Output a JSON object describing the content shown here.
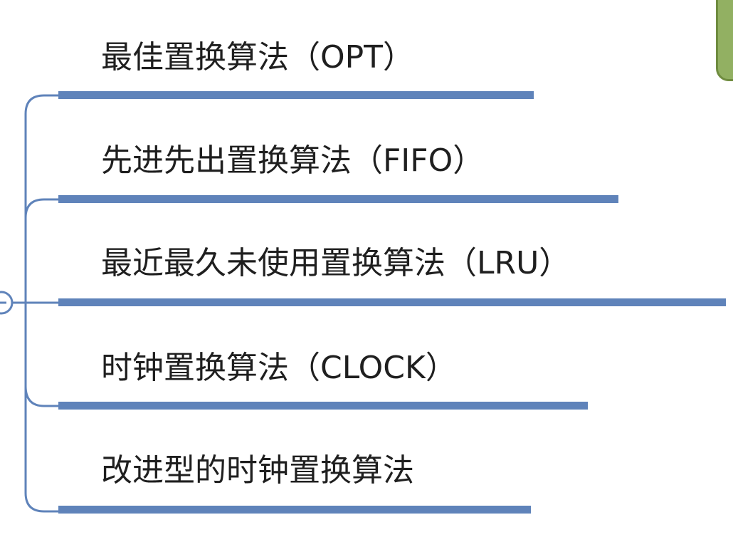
{
  "mindmap": {
    "branch_color": "#5f83ba",
    "corner_node_color": "#92b062",
    "topics": [
      {
        "label": "最佳置换算法（OPT）"
      },
      {
        "label": "先进先出置换算法（FIFO）"
      },
      {
        "label": "最近最久未使用置换算法（LRU）"
      },
      {
        "label": "时钟置换算法（CLOCK）"
      },
      {
        "label": "改进型的时钟置换算法"
      }
    ]
  }
}
